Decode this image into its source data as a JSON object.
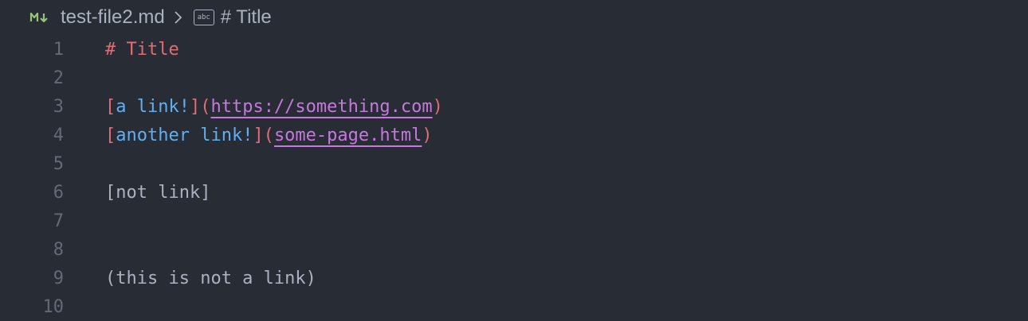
{
  "colors": {
    "background": "#282c34",
    "line_number": "#636a76",
    "plain_text": "#abb2bf",
    "heading": "#e06c75",
    "bracket": "#e06c75",
    "link_text": "#61afef",
    "url": "#c678dd",
    "markdown_icon": "#98c379"
  },
  "breadcrumb": {
    "file_icon": "markdown-icon",
    "file_name": "test-file2.md",
    "separator_icon": "chevron-right-icon",
    "symbol_icon": "string-symbol-icon",
    "symbol_icon_text": "abc",
    "symbol_name": "# Title"
  },
  "editor": {
    "lines": [
      {
        "number": "1",
        "heading": "# Title"
      },
      {
        "number": "2"
      },
      {
        "number": "3",
        "open_bracket": "[",
        "link_text": "a link!",
        "close_bracket": "](",
        "url": "https://something.com",
        "close_paren": ")"
      },
      {
        "number": "4",
        "open_bracket": "[",
        "link_text": "another link!",
        "close_bracket": "](",
        "url": "some-page.html",
        "close_paren": ")"
      },
      {
        "number": "5"
      },
      {
        "number": "6",
        "plain": "[not link]"
      },
      {
        "number": "7"
      },
      {
        "number": "8"
      },
      {
        "number": "9",
        "plain": "(this is not a link)"
      },
      {
        "number": "10"
      }
    ]
  }
}
